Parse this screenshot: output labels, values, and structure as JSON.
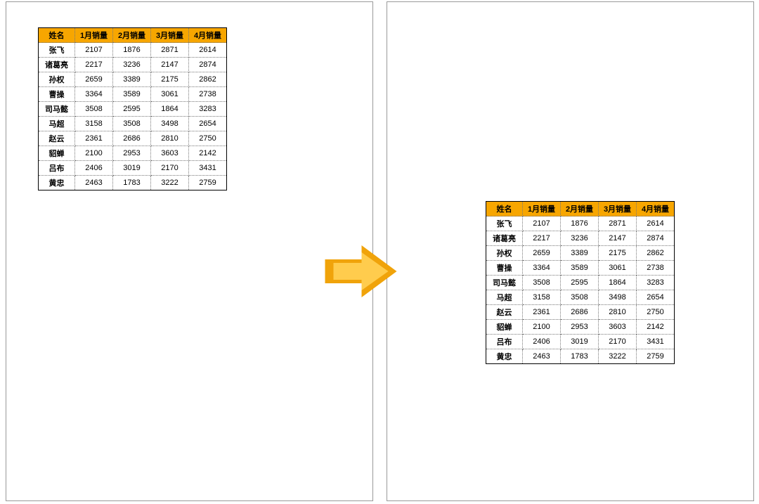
{
  "headers": [
    "姓名",
    "1月销量",
    "2月销量",
    "3月销量",
    "4月销量"
  ],
  "rows": [
    {
      "name": "张飞",
      "vals": [
        2107,
        1876,
        2871,
        2614
      ]
    },
    {
      "name": "诸葛亮",
      "vals": [
        2217,
        3236,
        2147,
        2874
      ]
    },
    {
      "name": "孙权",
      "vals": [
        2659,
        3389,
        2175,
        2862
      ]
    },
    {
      "name": "曹操",
      "vals": [
        3364,
        3589,
        3061,
        2738
      ]
    },
    {
      "name": "司马懿",
      "vals": [
        3508,
        2595,
        1864,
        3283
      ]
    },
    {
      "name": "马超",
      "vals": [
        3158,
        3508,
        3498,
        2654
      ]
    },
    {
      "name": "赵云",
      "vals": [
        2361,
        2686,
        2810,
        2750
      ]
    },
    {
      "name": "貂蝉",
      "vals": [
        2100,
        2953,
        3603,
        2142
      ]
    },
    {
      "name": "吕布",
      "vals": [
        2406,
        3019,
        2170,
        3431
      ]
    },
    {
      "name": "黄忠",
      "vals": [
        2463,
        1783,
        3222,
        2759
      ]
    }
  ],
  "arrow": {
    "name": "arrow-right-icon"
  }
}
